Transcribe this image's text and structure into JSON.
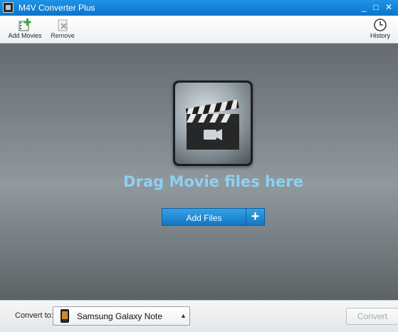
{
  "window": {
    "title": "M4V Converter Plus",
    "controls": {
      "minimize": "_",
      "maximize": "□",
      "close": "✕"
    }
  },
  "toolbar": {
    "add_movies": {
      "label": "Add Movies",
      "icon": "film-plus-icon",
      "accent": "#3aa63a"
    },
    "remove": {
      "label": "Remove",
      "icon": "film-remove-icon"
    },
    "history": {
      "label": "History",
      "icon": "clock-icon"
    }
  },
  "main": {
    "drop_prompt": "Drag Movie files here",
    "drop_icon": "clapperboard-icon",
    "add_files_label": "Add Files",
    "add_files_plus": "+",
    "accent": "#1a8ad8",
    "prompt_color": "#8fd0f0"
  },
  "bottom": {
    "convert_to_label": "Convert to:",
    "device_name": "Samsung Galaxy Note",
    "device_icon": "phone-icon",
    "dropdown_arrow": "▲",
    "convert_label": "Convert",
    "convert_enabled": false
  }
}
